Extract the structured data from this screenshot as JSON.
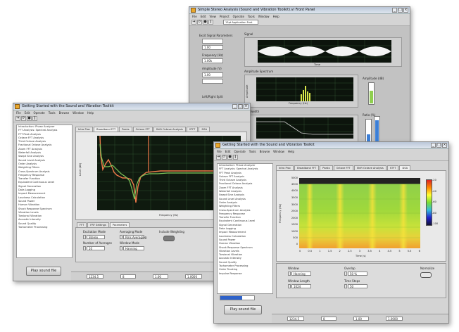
{
  "win1": {
    "title": "Simple Stereo Analysis (Sound and Vibration Toolkit).vi Front Panel",
    "menu": [
      "File",
      "Edit",
      "View",
      "Project",
      "Operate",
      "Tools",
      "Window",
      "Help"
    ],
    "font_ctrl": "13pt Application Font",
    "left_labels": [
      "Excit Signal Parameters",
      "Frequency (Hz)",
      "Amplitude (V)",
      "Left/Right Split"
    ],
    "left_values": [
      "1.00",
      "1.00k",
      "1.00"
    ],
    "plot_titles": [
      "Signal",
      "Amplitude Spectrum",
      "Bandwidth"
    ],
    "bar_labels": [
      "Amplitude (dB)",
      "Ratio (%)"
    ],
    "plot1_xlabel": "Time",
    "plot2_xlabel": "Frequency (Hz)",
    "plot2_ylabel": "Amplitude"
  },
  "win2": {
    "title": "Getting Started with the Sound and Vibration Toolkit",
    "menu": [
      "File",
      "Edit",
      "Operate",
      "Tools",
      "Browse",
      "Window",
      "Help"
    ],
    "tabs": [
      "Intro Proc",
      "Broadband FFT",
      "Peaks",
      "Octave FFT",
      "Shift Octave Analysis",
      "STFT",
      "DSA"
    ],
    "active_tab": "Broadband FFT",
    "bottom_tabs": [
      "FFT",
      "FRF Settings",
      "Parameters"
    ],
    "settings": [
      "Excitation Mode",
      "Averaging Mode",
      "Number of Averages",
      "Window Mode",
      "Include Weighting"
    ],
    "settings_values": [
      "Stereo",
      "Rms Averaging",
      "10",
      "Hanning",
      "On"
    ],
    "ylabel": "Level (dB)",
    "xlabel": "Frequency (Hz)",
    "play_button": "Play sound file",
    "status": [
      "1234.5",
      "8",
      "1.00",
      "1.0000"
    ],
    "list": [
      "Introduction: Phase Analyzer",
      "FFT Analysis: Spectral Analysis",
      "FFT Peak Analysis",
      "Octave FFT Analysis",
      "Third Octave Analysis",
      "Fractional Octave Analysis",
      "Zoom FFT Analysis",
      "Waterfall Analysis",
      "Swept Sine Analysis",
      "Sound Level Analysis",
      "Order Analysis",
      "Weighting Filters",
      "Cross-Spectrum Analysis",
      "Frequency Response",
      "Transfer Function",
      "Equivalent Continuous Level",
      "Signal Generation",
      "Data Logging",
      "Impact Measurement",
      "Loudness Calculation",
      "Sound Power",
      "Human Vibration",
      "Shock Response Spectrum",
      "Vibration Levels",
      "Torsional Vibration",
      "Acoustic Intensity",
      "Sound Quality",
      "Tachometer Processing"
    ]
  },
  "win3": {
    "title": "Getting Started with the Sound and Vibration Toolkit",
    "menu": [
      "File",
      "Edit",
      "Operate",
      "Tools",
      "Browse",
      "Window",
      "Help"
    ],
    "tabs": [
      "Intro Proc",
      "Broadband FFT",
      "Peaks",
      "Octave FFT",
      "Shift Octave Analysis",
      "STFT",
      "DSA"
    ],
    "active_tab": "STFT",
    "ylabel": "Frequency (Hz)",
    "xlabel": "Time (s)",
    "yticks": [
      "5000",
      "4500",
      "4000",
      "3500",
      "3000",
      "2500",
      "2000",
      "1500",
      "1000",
      "500",
      "0"
    ],
    "xticks": [
      "0",
      "0.5",
      "1",
      "1.5",
      "2",
      "2.5",
      "3",
      "3.5",
      "4",
      "4.5",
      "5",
      "5.5",
      "6"
    ],
    "colorbar_ticks": [
      "-20",
      "-40",
      "-60",
      "-80",
      "-100"
    ],
    "controls": [
      "Window",
      "Window Length",
      "Overlap",
      "Time Steps"
    ],
    "control_values": [
      "Hanning",
      "1024",
      "50 %",
      "50"
    ],
    "toggle_label": "Normalize",
    "play_button": "Play sound file",
    "status": [
      "1234.5",
      "8",
      "1.00",
      "1.0000"
    ],
    "list": [
      "Introduction: Phase Analyzer",
      "FFT Analysis: Spectral Analysis",
      "FFT Peak Analysis",
      "Octave FFT Analysis",
      "Third Octave Analysis",
      "Fractional Octave Analysis",
      "Zoom FFT Analysis",
      "Waterfall Analysis",
      "Swept Sine Analysis",
      "Sound Level Analysis",
      "Order Analysis",
      "Weighting Filters",
      "Cross-Spectrum Analysis",
      "Frequency Response",
      "Transfer Function",
      "Equivalent Continuous Level",
      "Signal Generation",
      "Data Logging",
      "Impact Measurement",
      "Loudness Calculation",
      "Sound Power",
      "Human Vibration",
      "Shock Response Spectrum",
      "Vibration Levels",
      "Torsional Vibration",
      "Acoustic Intensity",
      "Sound Quality",
      "Tachometer Processing",
      "Order Tracking",
      "Impulse Response"
    ],
    "progress": 0.65
  },
  "colors": {
    "plot_bg": "#0c140c",
    "grid": "#3a5a3a",
    "trace_orange": "#f07a4a",
    "trace_green": "#7ec65a",
    "progress": "#2e62c9"
  }
}
